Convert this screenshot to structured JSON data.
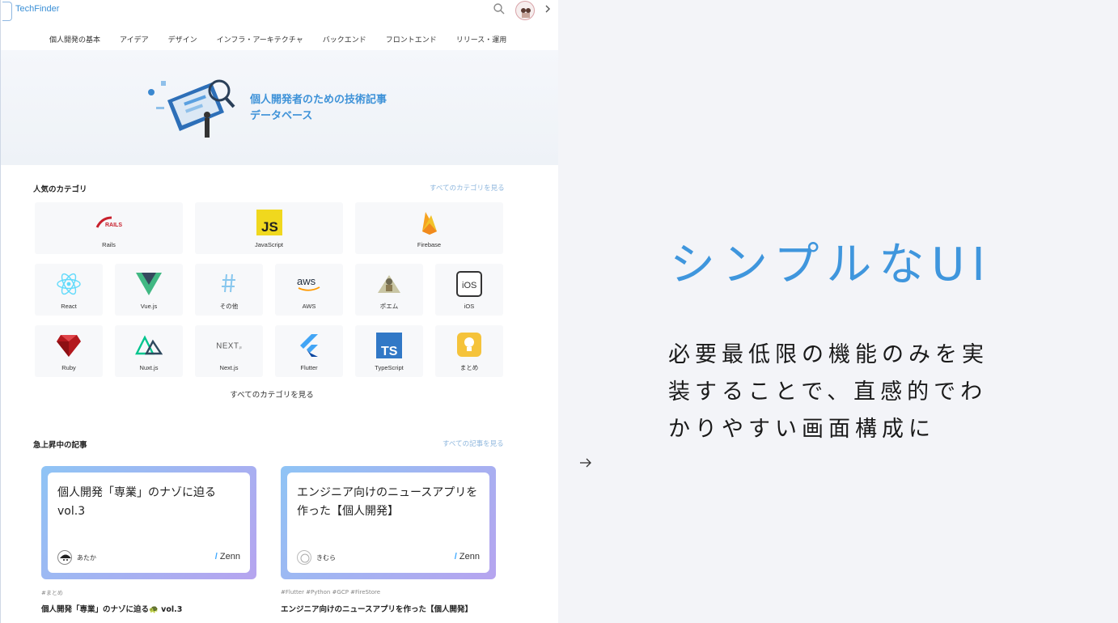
{
  "app": {
    "logo_text": "TechFinder",
    "nav": [
      "個人開発の基本",
      "アイデア",
      "デザイン",
      "インフラ・アーキテクチャ",
      "バックエンド",
      "フロントエンド",
      "リリース・運用"
    ],
    "hero_title_line1": "個人開発者のための技術記事",
    "hero_title_line2": "データベース",
    "popular_categories_title": "人気のカテゴリ",
    "see_all_categories_link": "すべてのカテゴリを見る",
    "categories_row1": [
      "Rails",
      "JavaScript",
      "Firebase"
    ],
    "categories_row2": [
      "React",
      "Vue.js",
      "その他",
      "AWS",
      "ポエム",
      "iOS"
    ],
    "categories_row3": [
      "Ruby",
      "Nuxt.js",
      "Next.js",
      "Flutter",
      "TypeScript",
      "まとめ"
    ],
    "all_categories_button": "すべてのカテゴリを見る",
    "rising_title": "急上昇中の記事",
    "see_all_articles_link": "すべての記事を見る",
    "articles": [
      {
        "card_title": "個人開発「専業」のナゾに迫る vol.3",
        "author": "あたか",
        "platform": "Zenn",
        "tags": "#まとめ",
        "caption": "個人開発「専業」のナゾに迫る🐢 vol.3"
      },
      {
        "card_title": "エンジニア向けのニュースアプリを作った【個人開発】",
        "author": "きむら",
        "platform": "Zenn",
        "tags": "#Flutter  #Python  #GCP  #FireStore",
        "caption": "エンジニア向けのニュースアプリを作った【個人開発】"
      }
    ]
  },
  "slide": {
    "headline": "シンプルなUI",
    "body": "必要最低限の機能のみを実装することで、直感的でわかりやすい画面構成に"
  },
  "colors": {
    "accent_blue": "#3f96dd",
    "link_blue": "#8db6dd",
    "gradient_start": "#8fc4f5",
    "gradient_end": "#b6a4ef"
  }
}
